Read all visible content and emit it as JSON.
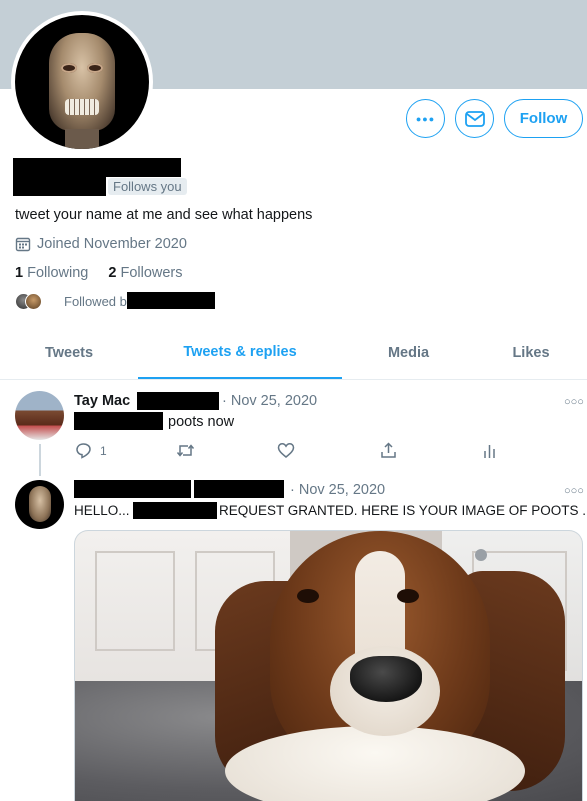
{
  "profile": {
    "follows_you": "Follows you",
    "bio": "tweet your name at me and see what happens",
    "joined": "Joined November 2020",
    "following_count": "1",
    "following_label": "Following",
    "followers_count": "2",
    "followers_label": "Followers",
    "followed_by": "Followed by",
    "follow_button": "Follow",
    "more_button_icon": "more-icon",
    "message_button_icon": "mail-icon"
  },
  "tabs": [
    "Tweets",
    "Tweets & replies",
    "Media",
    "Likes"
  ],
  "active_tab": "Tweets & replies",
  "tweets": [
    {
      "author": "Tay Mac",
      "date": "· Nov 25, 2020",
      "text": "poots now",
      "reply_count": "1"
    },
    {
      "date": "· Nov 25, 2020",
      "text_prefix": "HELLO...",
      "text_suffix": "REQUEST GRANTED. HERE IS YOUR IMAGE OF POOTS ."
    }
  ],
  "colors": {
    "accent": "#1da1f2",
    "banner": "#c4cfd6",
    "muted": "#657786"
  }
}
